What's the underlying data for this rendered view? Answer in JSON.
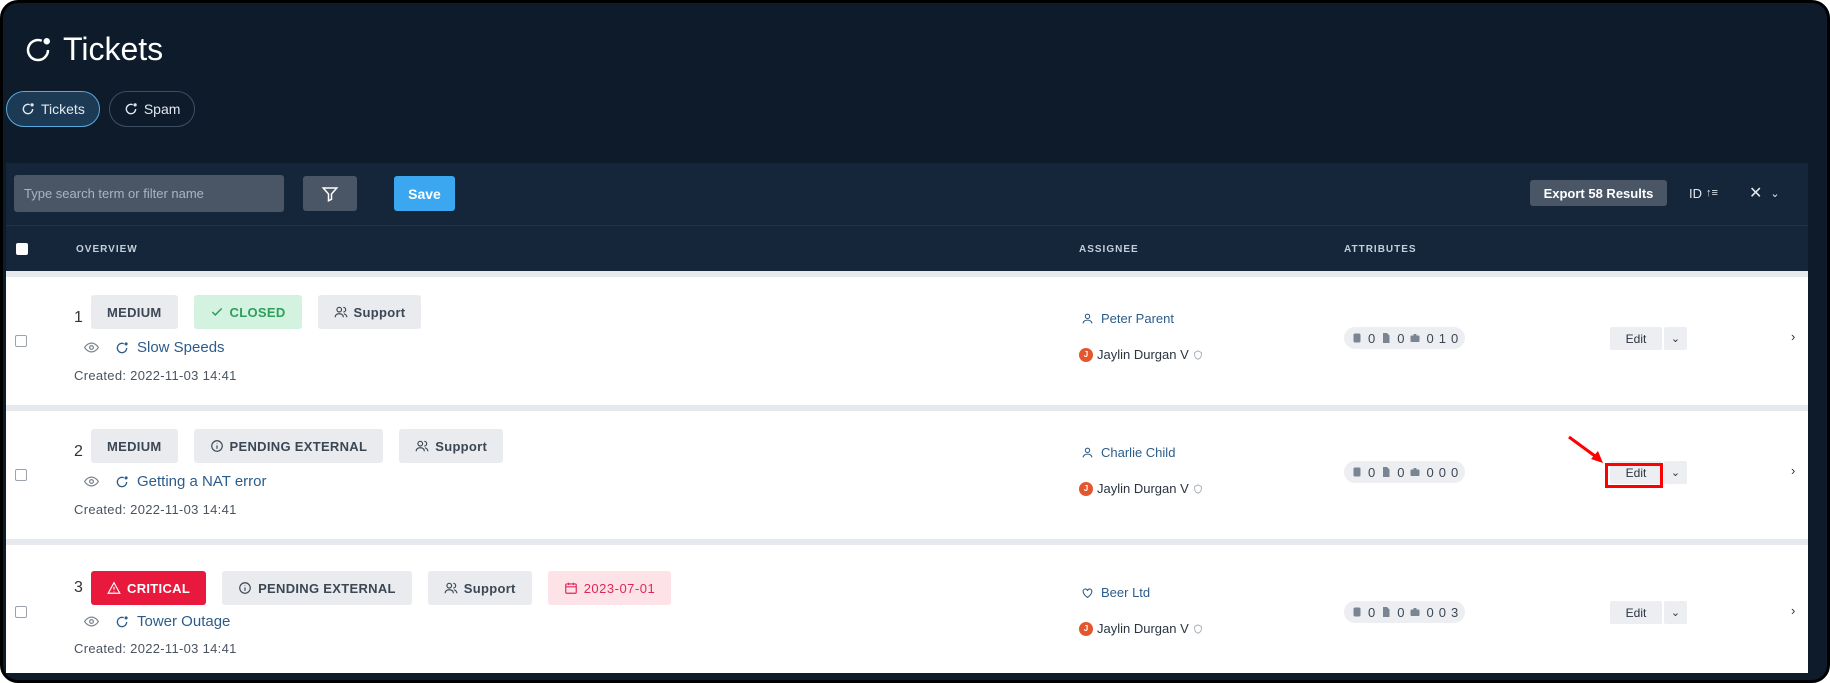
{
  "page": {
    "title": "Tickets"
  },
  "tabs": [
    {
      "label": "Tickets",
      "active": true
    },
    {
      "label": "Spam",
      "active": false
    }
  ],
  "toolbar": {
    "search_placeholder": "Type search term or filter name",
    "save_label": "Save",
    "export_label": "Export 58 Results",
    "sort_label": "ID",
    "sort_icon": "sort-ascending-icon"
  },
  "table": {
    "headers": {
      "overview": "OVERVIEW",
      "assignee": "ASSIGNEE",
      "attributes": "ATTRIBUTES"
    },
    "rows": [
      {
        "number": "1",
        "priority": "MEDIUM",
        "status": "CLOSED",
        "team": "Support",
        "due_date": "",
        "title": "Slow Speeds",
        "created": "Created: 2022-11-03 14:41",
        "assignee": "Peter Parent",
        "assignee_type": "user",
        "watcher": "Jaylin Durgan V",
        "watcher_initial": "J",
        "attrs": [
          "0",
          "0",
          "0",
          "1",
          "0"
        ],
        "edit_label": "Edit"
      },
      {
        "number": "2",
        "priority": "MEDIUM",
        "status": "PENDING EXTERNAL",
        "team": "Support",
        "due_date": "",
        "title": "Getting a NAT error",
        "created": "Created: 2022-11-03 14:41",
        "assignee": "Charlie Child",
        "assignee_type": "user",
        "watcher": "Jaylin Durgan V",
        "watcher_initial": "J",
        "attrs": [
          "0",
          "0",
          "0",
          "0",
          "0"
        ],
        "edit_label": "Edit"
      },
      {
        "number": "3",
        "priority": "CRITICAL",
        "status": "PENDING EXTERNAL",
        "team": "Support",
        "due_date": "2023-07-01",
        "title": "Tower Outage",
        "created": "Created: 2022-11-03 14:41",
        "assignee": "Beer Ltd",
        "assignee_type": "organization",
        "watcher": "Jaylin Durgan V",
        "watcher_initial": "J",
        "attrs": [
          "0",
          "0",
          "0",
          "0",
          "3"
        ],
        "edit_label": "Edit"
      }
    ]
  },
  "colors": {
    "header_bg": "#0d1b2a",
    "accent": "#3aa7f0",
    "closed": "#2f9e5c",
    "critical": "#e9193d",
    "date": "#e02656",
    "highlight": "#ff0000"
  }
}
